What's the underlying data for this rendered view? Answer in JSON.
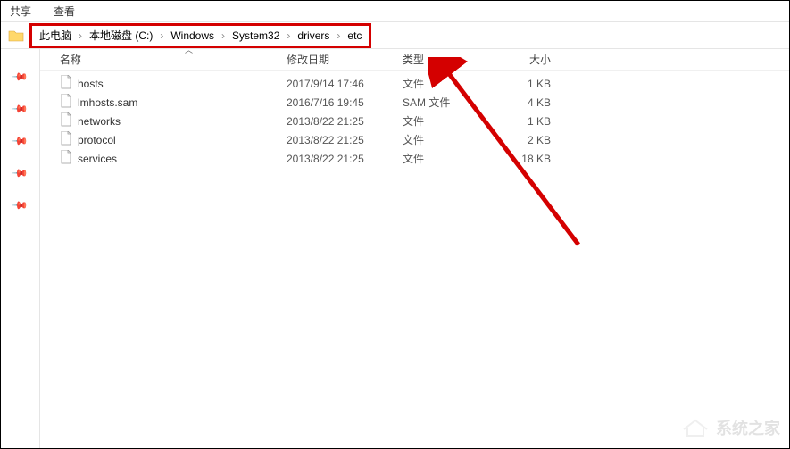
{
  "toolbar": {
    "share": "共享",
    "view": "查看"
  },
  "breadcrumb": {
    "items": [
      "此电脑",
      "本地磁盘 (C:)",
      "Windows",
      "System32",
      "drivers",
      "etc"
    ],
    "sep": "›"
  },
  "columns": {
    "name": "名称",
    "date": "修改日期",
    "type": "类型",
    "size": "大小"
  },
  "files": [
    {
      "name": "hosts",
      "date": "2017/9/14 17:46",
      "type": "文件",
      "size": "1 KB"
    },
    {
      "name": "lmhosts.sam",
      "date": "2016/7/16 19:45",
      "type": "SAM 文件",
      "size": "4 KB"
    },
    {
      "name": "networks",
      "date": "2013/8/22 21:25",
      "type": "文件",
      "size": "1 KB"
    },
    {
      "name": "protocol",
      "date": "2013/8/22 21:25",
      "type": "文件",
      "size": "2 KB"
    },
    {
      "name": "services",
      "date": "2013/8/22 21:25",
      "type": "文件",
      "size": "18 KB"
    }
  ],
  "watermark": "系统之家"
}
